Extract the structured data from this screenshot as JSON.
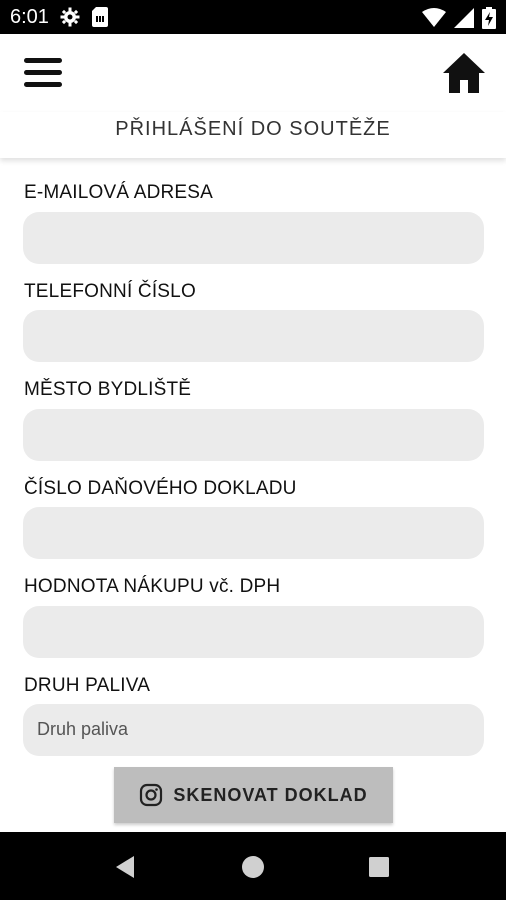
{
  "status_bar": {
    "time": "6:01",
    "icons": [
      "settings-icon",
      "sim-card-icon",
      "wifi-icon",
      "signal-icon",
      "battery-charging-icon"
    ]
  },
  "app_bar": {
    "menu_icon": "hamburger-menu-icon",
    "home_icon": "home-icon"
  },
  "page": {
    "title": "PŘIHLÁŠENÍ DO SOUTĚŽE"
  },
  "form": {
    "email": {
      "label": "E-MAILOVÁ ADRESA",
      "value": "",
      "placeholder": ""
    },
    "phone": {
      "label": "TELEFONNÍ ČÍSLO",
      "value": "",
      "placeholder": ""
    },
    "city": {
      "label": "MĚSTO BYDLIŠTĚ",
      "value": "",
      "placeholder": ""
    },
    "receipt_number": {
      "label": "ČÍSLO DAŇOVÉHO DOKLADU",
      "value": "",
      "placeholder": ""
    },
    "purchase_value": {
      "label": "HODNOTA NÁKUPU vč. DPH",
      "value": "",
      "placeholder": ""
    },
    "fuel_type": {
      "label": "DRUH PALIVA",
      "selected": "Druh paliva"
    }
  },
  "scan_button": {
    "label": "SKENOVAT DOKLAD",
    "icon": "camera-icon"
  },
  "nav_bar": {
    "icons": [
      "back-icon",
      "home-circle-icon",
      "recents-icon"
    ]
  },
  "colors": {
    "input_background": "#ebebeb",
    "button_background": "#bdbdbd",
    "system_bar": "#000000"
  }
}
